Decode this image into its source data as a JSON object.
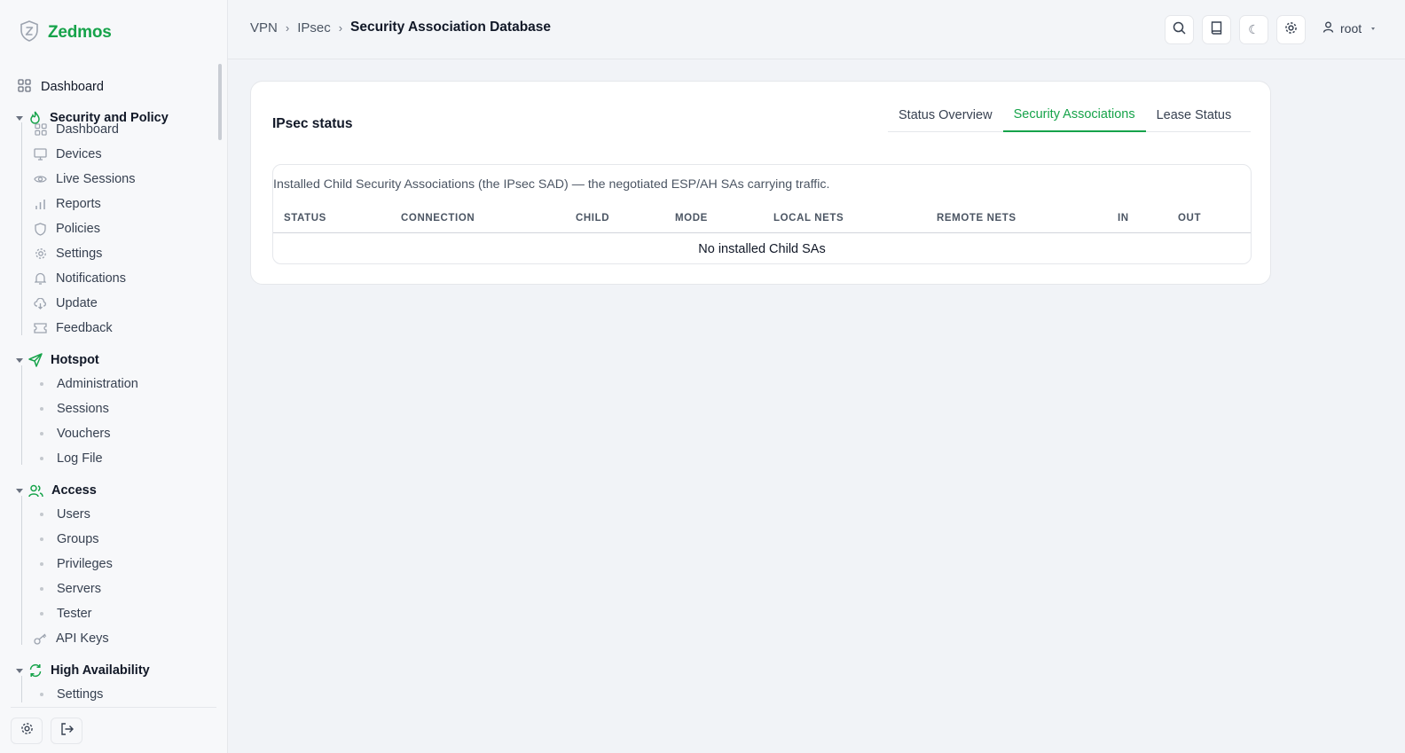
{
  "brand": {
    "name": "Zedmos"
  },
  "sidebar": {
    "top_item": {
      "label": "Dashboard",
      "icon": "grid-icon"
    },
    "groups": [
      {
        "label": "Security and Policy",
        "icon": "flame-icon",
        "items": [
          {
            "label": "Dashboard",
            "icon": "grid-icon"
          },
          {
            "label": "Devices",
            "icon": "monitor-icon"
          },
          {
            "label": "Live Sessions",
            "icon": "eye-icon"
          },
          {
            "label": "Reports",
            "icon": "bar-chart-icon"
          },
          {
            "label": "Policies",
            "icon": "shield-icon"
          },
          {
            "label": "Settings",
            "icon": "gear-icon"
          },
          {
            "label": "Notifications",
            "icon": "bell-icon"
          },
          {
            "label": "Update",
            "icon": "cloud-download-icon"
          },
          {
            "label": "Feedback",
            "icon": "ticket-icon"
          }
        ]
      },
      {
        "label": "Hotspot",
        "icon": "send-icon",
        "items": [
          {
            "label": "Administration"
          },
          {
            "label": "Sessions"
          },
          {
            "label": "Vouchers"
          },
          {
            "label": "Log File"
          }
        ]
      },
      {
        "label": "Access",
        "icon": "users-icon",
        "items": [
          {
            "label": "Users"
          },
          {
            "label": "Groups"
          },
          {
            "label": "Privileges"
          },
          {
            "label": "Servers"
          },
          {
            "label": "Tester"
          },
          {
            "label": "API Keys",
            "icon": "key-icon"
          }
        ]
      },
      {
        "label": "High Availability",
        "icon": "refresh-icon",
        "items": [
          {
            "label": "Settings"
          }
        ]
      }
    ]
  },
  "header": {
    "breadcrumb": [
      "VPN",
      "IPsec",
      "Security Association Database"
    ],
    "user": "root"
  },
  "card": {
    "title": "IPsec status",
    "tabs": [
      {
        "label": "Status Overview",
        "active": false
      },
      {
        "label": "Security Associations",
        "active": true
      },
      {
        "label": "Lease Status",
        "active": false
      }
    ],
    "caption": "Installed Child Security Associations (the IPsec SAD) — the negotiated ESP/AH SAs carrying traffic.",
    "columns": [
      "STATUS",
      "CONNECTION",
      "CHILD",
      "MODE",
      "LOCAL NETS",
      "REMOTE NETS",
      "IN",
      "OUT"
    ],
    "empty_text": "No installed Child SAs"
  },
  "colors": {
    "accent": "#16a34a",
    "background": "#f1f3f7"
  }
}
